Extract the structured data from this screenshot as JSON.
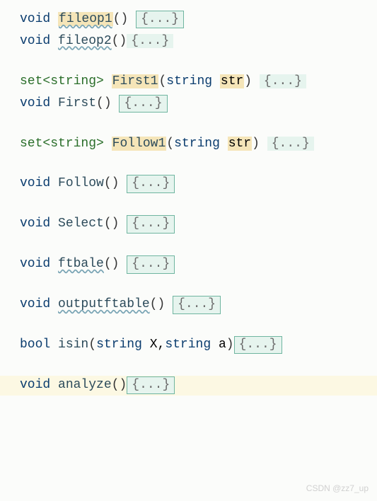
{
  "lines": [
    {
      "kw": "void",
      "fn": "fileop1",
      "wavy": true,
      "params": [],
      "hl_fn": true,
      "fold": "boxed",
      "space": true
    },
    {
      "kw": "void",
      "fn": "fileop2",
      "wavy": true,
      "params": [],
      "hl_fn": false,
      "fold": "plain",
      "space": false
    },
    null,
    {
      "kw": "set<string>",
      "fn": "First1",
      "wavy": false,
      "params": [
        {
          "type": "string",
          "name": "str",
          "hl": true
        }
      ],
      "hl_fn": true,
      "fold": "plain",
      "space": true
    },
    {
      "kw": "void",
      "fn": "First",
      "wavy": false,
      "params": [],
      "hl_fn": false,
      "fold": "boxed",
      "space": true
    },
    null,
    {
      "kw": "set<string>",
      "fn": "Follow1",
      "wavy": false,
      "params": [
        {
          "type": "string",
          "name": "str",
          "hl": true
        }
      ],
      "hl_fn": true,
      "fold": "plain",
      "space": true
    },
    null,
    {
      "kw": "void",
      "fn": "Follow",
      "wavy": false,
      "params": [],
      "hl_fn": false,
      "fold": "boxed",
      "space": true
    },
    null,
    {
      "kw": "void",
      "fn": "Select",
      "wavy": false,
      "params": [],
      "hl_fn": false,
      "fold": "boxed",
      "space": true
    },
    null,
    {
      "kw": "void",
      "fn": "ftbale",
      "wavy": true,
      "params": [],
      "hl_fn": false,
      "fold": "boxed",
      "space": true
    },
    null,
    {
      "kw": "void",
      "fn": "outputftable",
      "wavy": true,
      "params": [],
      "hl_fn": false,
      "fold": "boxed",
      "space": true
    },
    null,
    {
      "kw": "bool",
      "fn": "isin",
      "wavy": false,
      "params": [
        {
          "type": "string",
          "name": "X",
          "hl": false
        },
        {
          "type": "string",
          "name": "a",
          "hl": false
        }
      ],
      "hl_fn": false,
      "fold": "boxed",
      "space": false
    },
    null,
    {
      "kw": "void",
      "fn": "analyze",
      "wavy": false,
      "params": [],
      "hl_fn": false,
      "fold": "boxed",
      "space": false,
      "line_hl": true
    }
  ],
  "fold_text": "{...}",
  "watermark": "CSDN @zz7_up"
}
